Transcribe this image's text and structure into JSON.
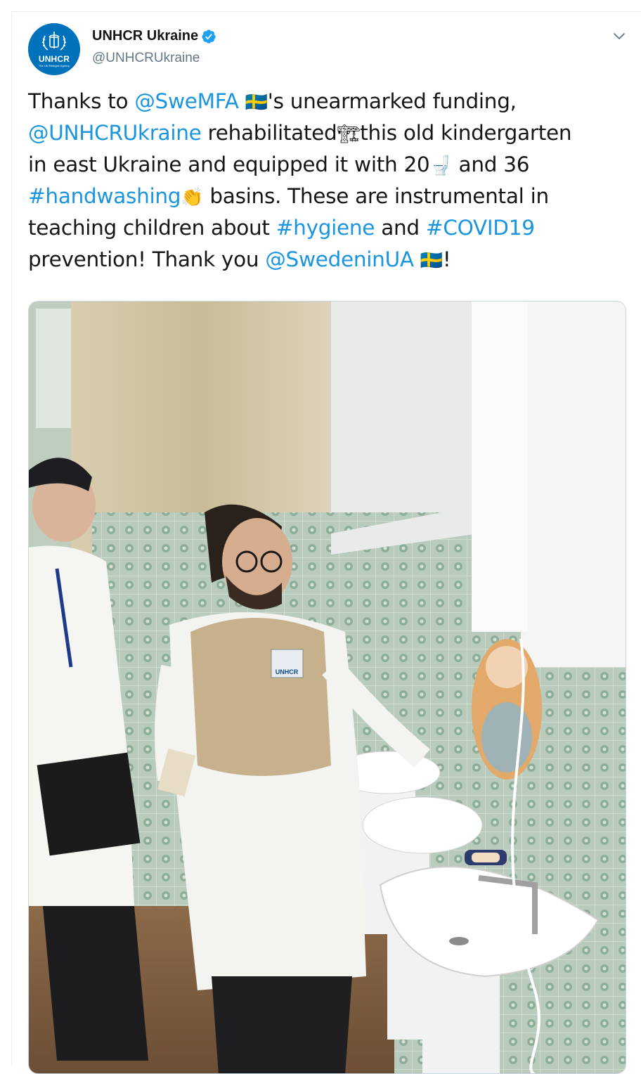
{
  "tweet": {
    "author": {
      "display_name": "UNHCR Ukraine",
      "handle": "@UNHCRUkraine",
      "avatar_text": "UNHCR",
      "avatar_subtext": "The UN Refugee Agency",
      "verified": true,
      "verified_icon": "verified-badge-icon",
      "avatar_icon": "unhcr-logo-icon"
    },
    "menu_icon": "chevron-down-icon",
    "text": {
      "l1_a": "Thanks to ",
      "l1_link": "@SweMFA",
      "l1_emoji": "🇸🇪",
      "l1_b": "'s unearmarked funding,",
      "l2_link": "@UNHCRUkraine",
      "l2_a": " rehabilitated",
      "l2_emoji": "🏗",
      "l2_b": "this old kindergarten",
      "l3_a": "in east Ukraine and equipped it with 20",
      "l3_emoji": "🚽",
      "l3_b": " and 36",
      "l4_link": "#handwashing",
      "l4_emoji": "👏",
      "l4_b": " basins. These are instrumental in",
      "l5_a": "teaching children about ",
      "l5_link1": "#hygiene",
      "l5_b": " and ",
      "l5_link2": "#COVID19",
      "l6_a": " prevention! Thank you ",
      "l6_link": "@SwedeninUA",
      "l6_emoji": "🇸🇪",
      "l6_b": "!"
    },
    "media": {
      "alt": "Two men in white coats inspecting children's washbasins in a tiled kindergarten bathroom",
      "vest_text": "UNHCR"
    },
    "colors": {
      "link": "#1b95e0",
      "text": "#14171a",
      "secondary": "#657786",
      "brand": "#0072bc"
    }
  }
}
